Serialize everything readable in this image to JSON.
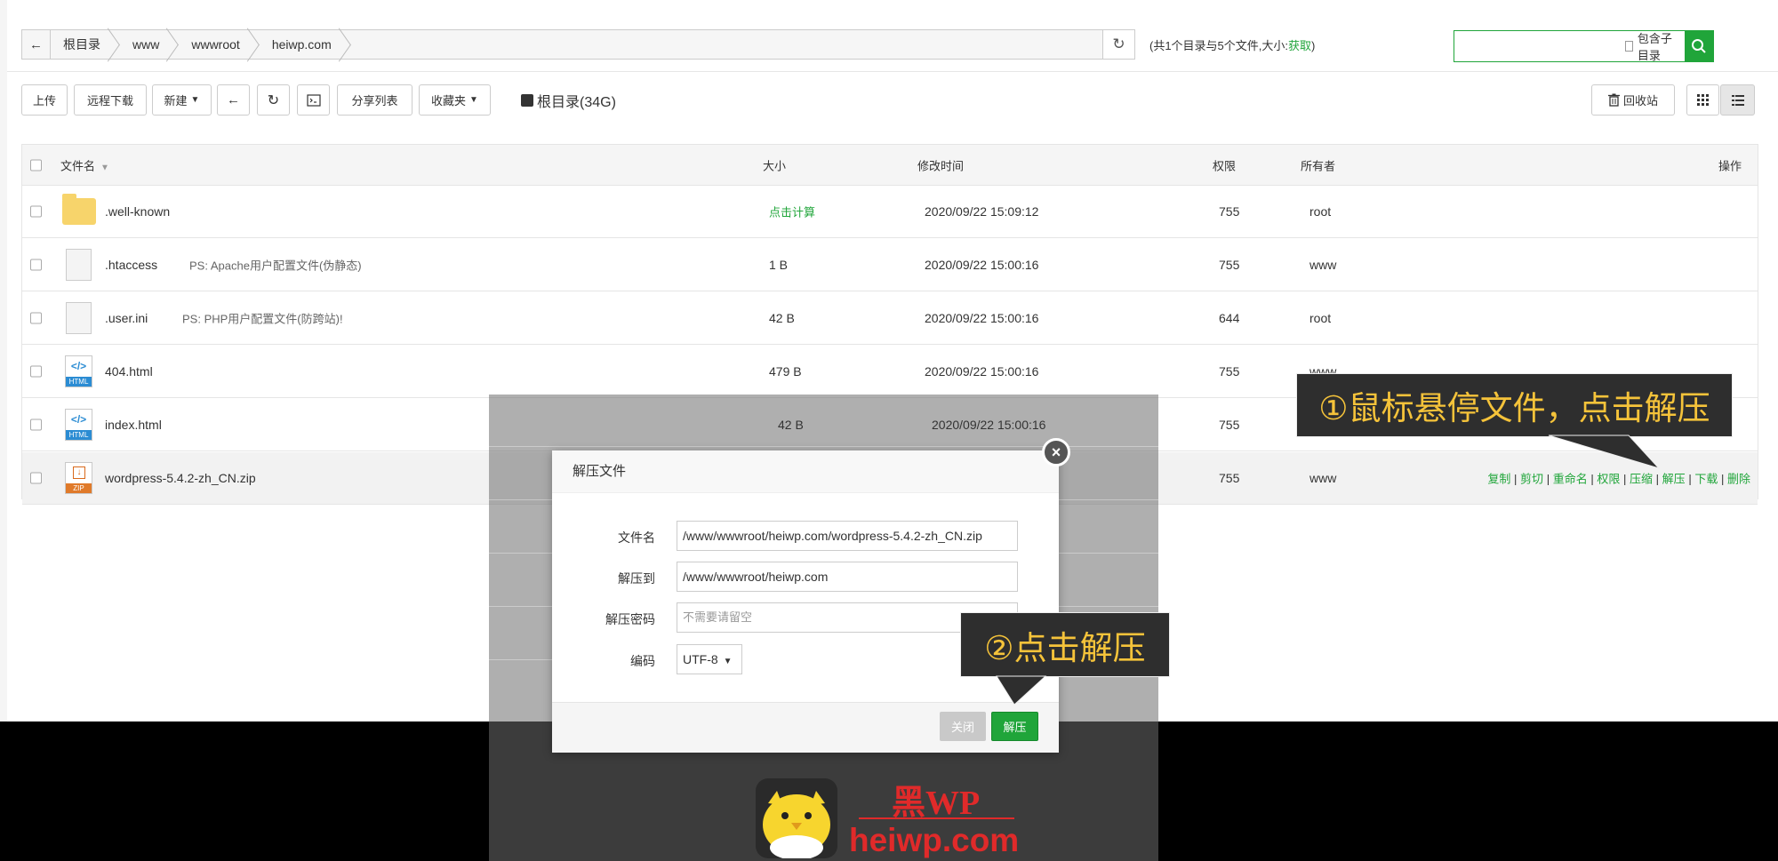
{
  "pathbar": {
    "crumbs": [
      "根目录",
      "www",
      "wwwroot",
      "heiwp.com"
    ],
    "info_prefix": "(共1个目录与5个文件,大小:",
    "info_link": "获取",
    "info_suffix": ")"
  },
  "search": {
    "placeholder": "",
    "include_subdir_label": "包含子目录"
  },
  "toolbar": {
    "upload": "上传",
    "remote_download": "远程下载",
    "new": "新建",
    "share_list": "分享列表",
    "favorites": "收藏夹",
    "disk_label": "根目录(34G)",
    "recycle_bin": "回收站"
  },
  "table": {
    "headers": {
      "name": "文件名",
      "size": "大小",
      "mtime": "修改时间",
      "perm": "权限",
      "owner": "所有者",
      "ops": "操作"
    },
    "rows": [
      {
        "name": ".well-known",
        "ps": "",
        "size": "点击计算",
        "mtime": "2020/09/22 15:09:12",
        "perm": "755",
        "owner": "root",
        "icon": "folder-icon"
      },
      {
        "name": ".htaccess",
        "ps": "PS: Apache用户配置文件(伪静态)",
        "size": "1 B",
        "mtime": "2020/09/22 15:00:16",
        "perm": "755",
        "owner": "www",
        "icon": "file-icon"
      },
      {
        "name": ".user.ini",
        "ps": "PS: PHP用户配置文件(防跨站)!",
        "size": "42 B",
        "mtime": "2020/09/22 15:00:16",
        "perm": "644",
        "owner": "root",
        "icon": "file-icon"
      },
      {
        "name": "404.html",
        "ps": "",
        "size": "479 B",
        "mtime": "2020/09/22 15:00:16",
        "perm": "755",
        "owner": "www",
        "icon": "html-icon"
      },
      {
        "name": "index.html",
        "ps": "",
        "size": "42 B",
        "mtime": "2020/09/22 15:00:16",
        "perm": "755",
        "owner": "",
        "icon": "html-icon"
      },
      {
        "name": "wordpress-5.4.2-zh_CN.zip",
        "ps": "",
        "size": "",
        "mtime": "",
        "perm": "755",
        "owner": "www",
        "icon": "zip-icon"
      }
    ],
    "ops": [
      "复制",
      "剪切",
      "重命名",
      "权限",
      "压缩",
      "解压",
      "下载",
      "删除"
    ],
    "ops_sep": "|"
  },
  "dialog": {
    "title": "解压文件",
    "file_label": "文件名",
    "file_value": "/www/wwwroot/heiwp.com/wordpress-5.4.2-zh_CN.zip",
    "dest_label": "解压到",
    "dest_value": "/www/wwwroot/heiwp.com",
    "pwd_label": "解压密码",
    "pwd_placeholder": "不需要请留空",
    "enc_label": "编码",
    "enc_value": "UTF-8",
    "close_btn": "关闭",
    "unzip_btn": "解压"
  },
  "callouts": {
    "one": "①鼠标悬停文件，点击解压",
    "two": "②点击解压"
  },
  "watermark": {
    "cn": "黑WP",
    "url": "heiwp.com"
  },
  "colors": {
    "accent": "#20a53a",
    "callout_text": "#f5c33a",
    "watermark": "#e02a2a"
  }
}
